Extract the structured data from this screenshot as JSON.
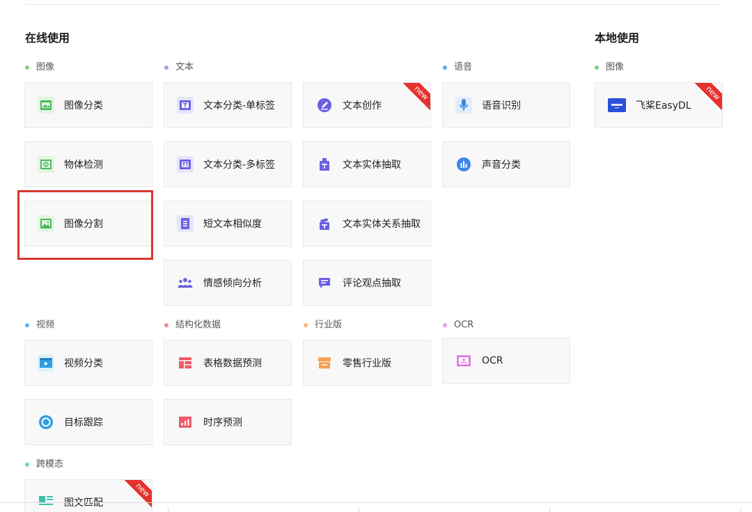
{
  "sections": {
    "online": "在线使用",
    "local": "本地使用"
  },
  "categories": {
    "online_image": "图像",
    "text": "文本",
    "speech": "语音",
    "local_image": "图像",
    "video": "视频",
    "structured": "结构化数据",
    "industry": "行业版",
    "ocr": "OCR",
    "cross_modal": "跨模态"
  },
  "category_colors": {
    "image": "#7ccf87",
    "text": "#a59cf0",
    "speech": "#5fa6f4",
    "video": "#5bb8f0",
    "structured": "#f08c94",
    "industry": "#f5b274",
    "ocr": "#e9a3ec",
    "cross_modal": "#6fd4c9"
  },
  "cards": {
    "image_classification": "图像分类",
    "object_detection": "物体检测",
    "image_segmentation": "图像分割",
    "text_single_label": "文本分类-单标签",
    "text_multi_label": "文本分类-多标签",
    "short_text_similarity": "短文本相似度",
    "sentiment_analysis": "情感倾向分析",
    "text_creation": "文本创作",
    "entity_extraction": "文本实体抽取",
    "entity_relation_extraction": "文本实体关系抽取",
    "opinion_extraction": "评论观点抽取",
    "speech_recognition": "语音识别",
    "sound_classification": "声音分类",
    "paddle_easydl": "飞桨EasyDL",
    "video_classification": "视频分类",
    "object_tracking": "目标跟踪",
    "table_prediction": "表格数据预测",
    "time_series": "时序预测",
    "retail": "零售行业版",
    "ocr": "OCR",
    "image_text_match": "图文匹配"
  },
  "badges": {
    "new": "new"
  },
  "icons": {
    "image_classification": "image-icon",
    "object_detection": "detection-icon",
    "image_segmentation": "segmentation-icon",
    "text_single_label": "text-tag-icon",
    "text_multi_label": "text-tag-icon",
    "short_text_similarity": "document-icon",
    "sentiment_analysis": "people-icon",
    "text_creation": "pen-icon",
    "entity_extraction": "box-icon",
    "entity_relation_extraction": "boxes-icon",
    "opinion_extraction": "comment-icon",
    "speech_recognition": "microphone-icon",
    "sound_classification": "sound-bars-icon",
    "paddle_easydl": "easydl-logo-icon",
    "video_classification": "video-icon",
    "object_tracking": "target-icon",
    "table_prediction": "table-icon",
    "time_series": "chart-icon",
    "retail": "shop-icon",
    "ocr": "ocr-icon",
    "image_text_match": "image-text-icon"
  }
}
